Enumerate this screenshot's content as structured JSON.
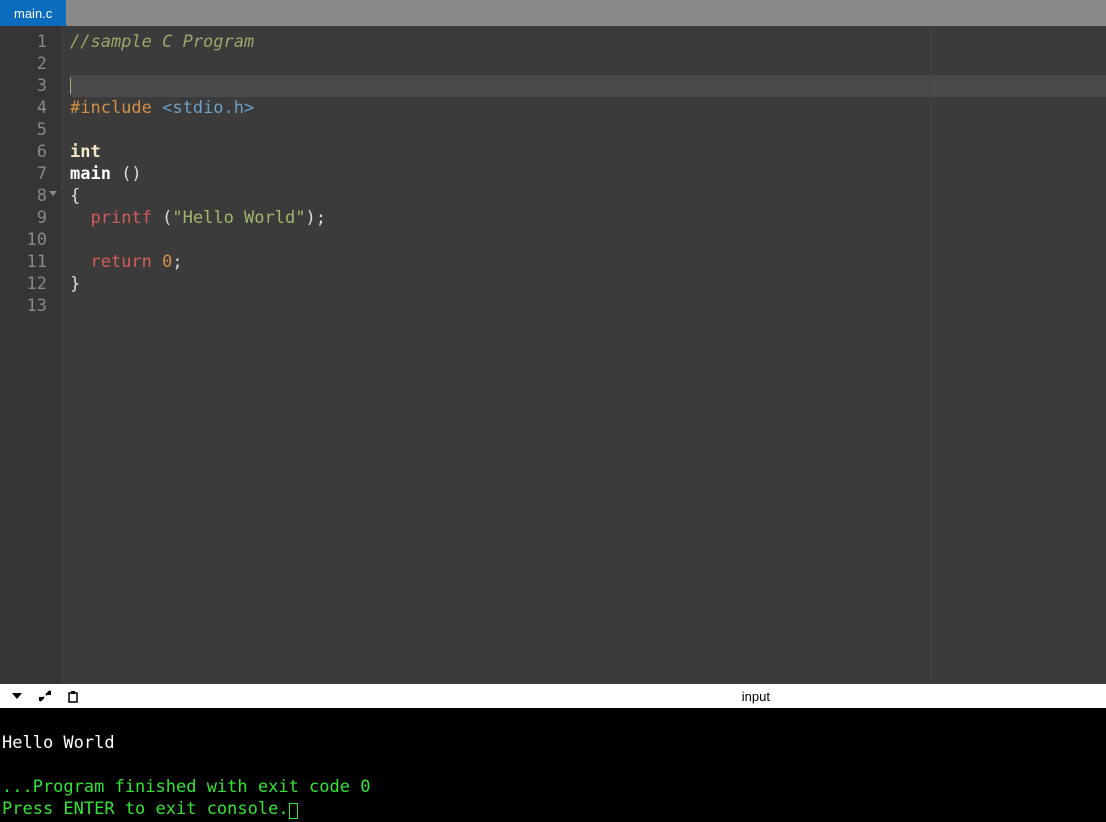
{
  "tab": {
    "name": "main.c"
  },
  "gutter": [
    "1",
    "2",
    "3",
    "4",
    "5",
    "6",
    "7",
    "8",
    "9",
    "10",
    "11",
    "12",
    "13"
  ],
  "code": {
    "l1_comment": "//sample C Program",
    "l4_include": "#include",
    "l4_header": " <stdio.h>",
    "l6_int": "int",
    "l7_main": "main",
    "l7_parens": " ()",
    "l8_brace": "{",
    "l9_indent": "  ",
    "l9_printf": "printf",
    "l9_open": " (",
    "l9_str": "\"Hello World\"",
    "l9_close": ");",
    "l11_indent": "  ",
    "l11_return": "return",
    "l11_sp": " ",
    "l11_num": "0",
    "l11_semi": ";",
    "l12_brace": "}"
  },
  "panel": {
    "input_label": "input"
  },
  "console": {
    "line1": "Hello World",
    "blank": "",
    "line2": "...Program finished with exit code 0",
    "line3": "Press ENTER to exit console."
  }
}
